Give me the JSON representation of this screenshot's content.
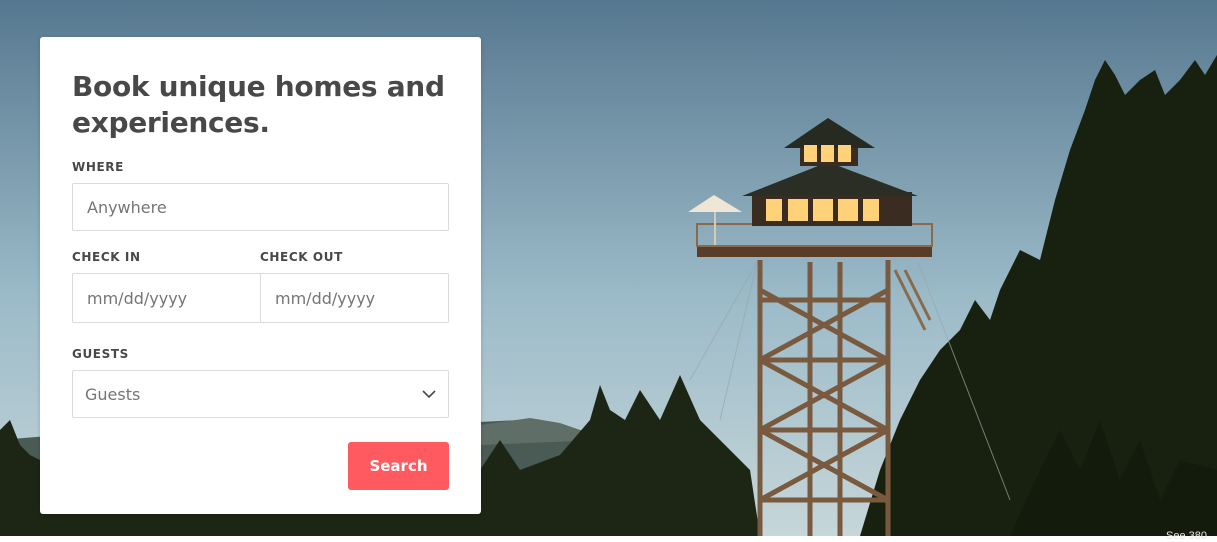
{
  "hero": {
    "scene": "fire-lookout-tower-at-dusk",
    "colors": {
      "sky_top": "#5b7f98",
      "sky_bottom": "#c2d6de",
      "forest": "#1c2414",
      "tower": "#7a5a3e",
      "window_glow": "#ffd27a"
    },
    "corner_text": "See 380"
  },
  "search_card": {
    "title": "Book unique homes and experiences.",
    "where": {
      "label": "WHERE",
      "placeholder": "Anywhere"
    },
    "check_in": {
      "label": "CHECK IN",
      "placeholder": "mm/dd/yyyy"
    },
    "check_out": {
      "label": "CHECK OUT",
      "placeholder": "mm/dd/yyyy"
    },
    "guests": {
      "label": "GUESTS",
      "value": "Guests",
      "icon": "chevron-down-icon"
    },
    "search_button": {
      "label": "Search",
      "color": "#ff5a5f"
    }
  }
}
